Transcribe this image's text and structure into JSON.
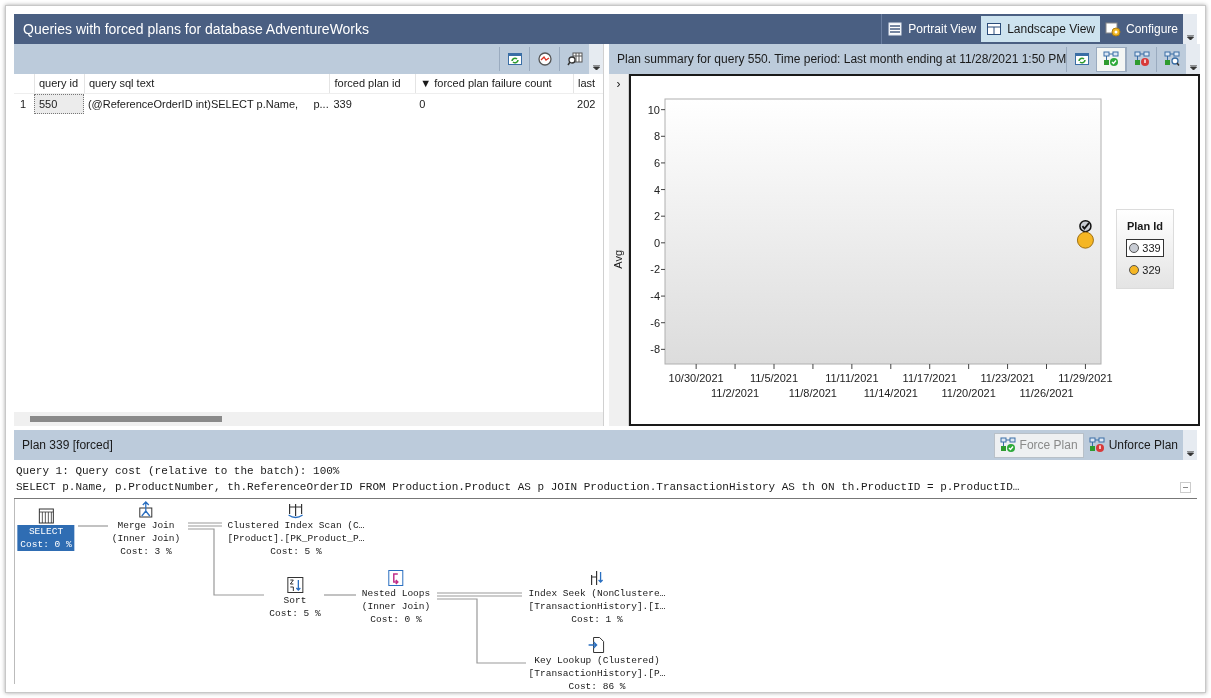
{
  "window": {
    "title": "Queries with forced plans for database AdventureWorks"
  },
  "view_buttons": [
    {
      "label": "Portrait View",
      "kind": "portrait",
      "selected": false
    },
    {
      "label": "Landscape View",
      "kind": "landscape",
      "selected": true
    },
    {
      "label": "Configure",
      "kind": "configure",
      "selected": false
    }
  ],
  "grid_toolbar": [
    {
      "kind": "refresh"
    },
    {
      "kind": "gauge"
    },
    {
      "kind": "query-detail"
    }
  ],
  "grid": {
    "columns": [
      "query id",
      "query sql text",
      "forced plan id",
      "▼ forced plan failure count",
      "last"
    ],
    "rows": [
      {
        "number": "1",
        "selected": true,
        "cells": [
          "550",
          "(@ReferenceOrderID int)SELECT p.Name,     p....",
          "339",
          "0",
          "202"
        ]
      }
    ]
  },
  "summary": {
    "title": "Plan summary for query 550. Time period: Last month ending at 11/28/2021 1:50 PM",
    "toolbar": [
      {
        "kind": "refresh",
        "selected": false
      },
      {
        "kind": "force",
        "selected": true
      },
      {
        "kind": "unforce",
        "selected": false
      },
      {
        "kind": "compare",
        "selected": false
      }
    ],
    "expander": "›",
    "legend_title": "Plan Id",
    "plan_states": [
      {
        "forced": true
      },
      {
        "forced": false
      }
    ],
    "chart_data": {
      "type": "scatter",
      "ylabel": "Avg",
      "legend": "right",
      "ylim": [
        -9.1,
        10.8
      ],
      "yticks": [
        10,
        8,
        6,
        4,
        2,
        0,
        -2,
        -4,
        -6,
        -8
      ],
      "categories": [
        "10/30/2021",
        "11/2/2021",
        "11/5/2021",
        "11/8/2021",
        "11/11/2021",
        "11/14/2021",
        "11/17/2021",
        "11/20/2021",
        "11/23/2021",
        "11/26/2021",
        "11/29/2021"
      ],
      "series": [
        {
          "name": "339",
          "color": "#c8ccd4",
          "values": [
            null,
            null,
            null,
            null,
            null,
            null,
            null,
            null,
            null,
            null,
            1.25
          ]
        },
        {
          "name": "329",
          "color": "#f5b623",
          "values": [
            null,
            null,
            null,
            null,
            null,
            null,
            null,
            null,
            null,
            null,
            0.2
          ]
        }
      ]
    }
  },
  "plan": {
    "title": "Plan 339 [forced]",
    "buttons": [
      {
        "label": "Force Plan",
        "kind": "force",
        "disabled": true
      },
      {
        "label": "Unforce Plan",
        "kind": "unforce",
        "disabled": false
      }
    ],
    "query_lines": [
      "Query 1: Query cost (relative to the batch): 100%",
      "SELECT p.Name, p.ProductNumber, th.ReferenceOrderID FROM Production.Product AS p JOIN Production.TransactionHistory AS th ON th.ProductID = p.ProductID…"
    ],
    "nodes": [
      {
        "kind": "select",
        "selected": true,
        "lines": [
          "SELECT",
          "Cost: 0 %"
        ]
      },
      {
        "kind": "merge",
        "selected": false,
        "lines": [
          "Merge Join",
          "(Inner Join)",
          "Cost: 3 %"
        ]
      },
      {
        "kind": "scan",
        "selected": false,
        "lines": [
          "Clustered Index Scan (C…",
          "[Product].[PK_Product_P…",
          "Cost: 5 %"
        ]
      },
      {
        "kind": "sort",
        "selected": false,
        "lines": [
          "Sort",
          "Cost: 5 %"
        ]
      },
      {
        "kind": "loops",
        "selected": false,
        "lines": [
          "Nested Loops",
          "(Inner Join)",
          "Cost: 0 %"
        ]
      },
      {
        "kind": "seek",
        "selected": false,
        "lines": [
          "Index Seek (NonClustere…",
          "[TransactionHistory].[I…",
          "Cost: 1 %"
        ]
      },
      {
        "kind": "lookup",
        "selected": false,
        "lines": [
          "Key Lookup (Clustered)",
          "[TransactionHistory].[P…",
          "Cost: 86 %"
        ]
      }
    ]
  }
}
